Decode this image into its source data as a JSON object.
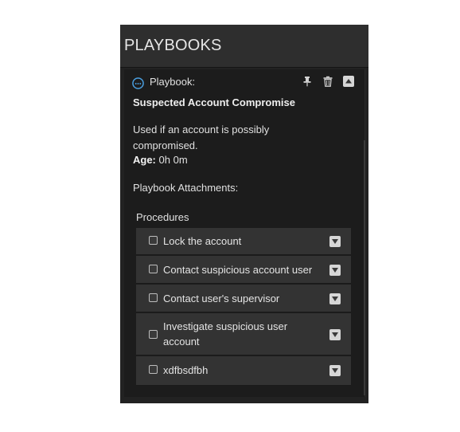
{
  "panel": {
    "title": "PLAYBOOKS"
  },
  "playbook": {
    "label": "Playbook:",
    "name": "Suspected Account Compromise",
    "description": "Used if an account is possibly compromised.",
    "age_label": "Age:",
    "age_value": "0h 0m",
    "attachments_label": "Playbook Attachments:",
    "procedures_label": "Procedures",
    "procedures": [
      {
        "label": "Lock the account",
        "checked": false
      },
      {
        "label": "Contact suspicious account user",
        "checked": false
      },
      {
        "label": "Contact user's supervisor",
        "checked": false
      },
      {
        "label": "Investigate suspicious user account",
        "checked": false
      },
      {
        "label": "xdfbsdfbh",
        "checked": false
      }
    ]
  },
  "icons": {
    "playbook": "playbook-circle-icon",
    "pin": "pin-icon",
    "delete": "trash-icon",
    "collapse": "collapse-up-icon",
    "expand": "chevron-down-icon"
  },
  "colors": {
    "panel_bg": "#222222",
    "header_bg": "#2e2e2e",
    "row_bg": "#333333",
    "accent": "#4a9fe0"
  }
}
